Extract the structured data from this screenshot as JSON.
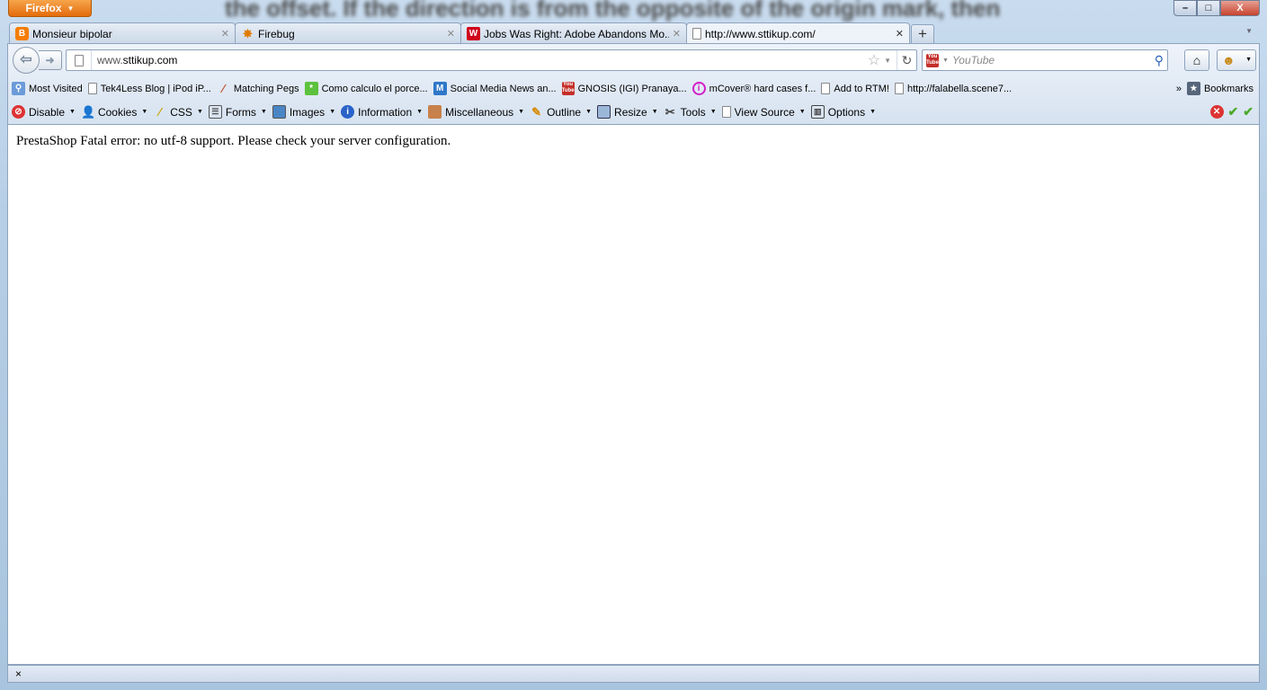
{
  "background_text": "the offset. If the direction is from the opposite of the origin mark, then",
  "app_menu": {
    "label": "Firefox"
  },
  "window_controls": {
    "minimize": "–",
    "maximize": "□",
    "close": "X"
  },
  "tabs": [
    {
      "title": "Monsieur bipolar",
      "icon": "blogger-icon",
      "active": false
    },
    {
      "title": "Firebug",
      "icon": "firebug-icon",
      "active": false
    },
    {
      "title": "Jobs Was Right: Adobe Abandons Mo...",
      "icon": "site-icon",
      "active": false
    },
    {
      "title": "http://www.sttikup.com/",
      "icon": "page-icon",
      "active": true
    }
  ],
  "new_tab": "+",
  "url": {
    "prefix": "www.",
    "domain": "sttikup.com"
  },
  "search": {
    "engine": "YouTube",
    "placeholder": "YouTube"
  },
  "bookmarks": [
    {
      "label": "Most Visited",
      "icon": "most-visited-icon"
    },
    {
      "label": "Tek4Less Blog | iPod iP...",
      "icon": "page-icon"
    },
    {
      "label": "Matching Pegs",
      "icon": "pegs-icon"
    },
    {
      "label": "Como calculo el porce...",
      "icon": "green-star-icon"
    },
    {
      "label": "Social Media News an...",
      "icon": "m-icon"
    },
    {
      "label": "GNOSIS (IGI) Pranaya...",
      "icon": "youtube-icon"
    },
    {
      "label": "mCover® hard cases f...",
      "icon": "info-pink-icon"
    },
    {
      "label": "Add to RTM!",
      "icon": "page-icon"
    },
    {
      "label": "http://falabella.scene7...",
      "icon": "page-icon"
    }
  ],
  "bookmarks_overflow": "»",
  "bookmarks_menu": "Bookmarks",
  "webdev_toolbar": [
    {
      "label": "Disable",
      "icon": "disable-icon"
    },
    {
      "label": "Cookies",
      "icon": "cookies-icon"
    },
    {
      "label": "CSS",
      "icon": "css-icon"
    },
    {
      "label": "Forms",
      "icon": "forms-icon"
    },
    {
      "label": "Images",
      "icon": "images-icon"
    },
    {
      "label": "Information",
      "icon": "information-icon"
    },
    {
      "label": "Miscellaneous",
      "icon": "miscellaneous-icon"
    },
    {
      "label": "Outline",
      "icon": "outline-icon"
    },
    {
      "label": "Resize",
      "icon": "resize-icon"
    },
    {
      "label": "Tools",
      "icon": "tools-icon"
    },
    {
      "label": "View Source",
      "icon": "view-source-icon"
    },
    {
      "label": "Options",
      "icon": "options-icon"
    }
  ],
  "page": {
    "message": "PrestaShop Fatal error: no utf-8 support. Please check your server configuration."
  },
  "status_bar": {
    "close": "×"
  },
  "colors": {
    "firefox_button": "#e36c0d",
    "chrome": "#d6e2f0",
    "close_button": "#c6432e"
  }
}
